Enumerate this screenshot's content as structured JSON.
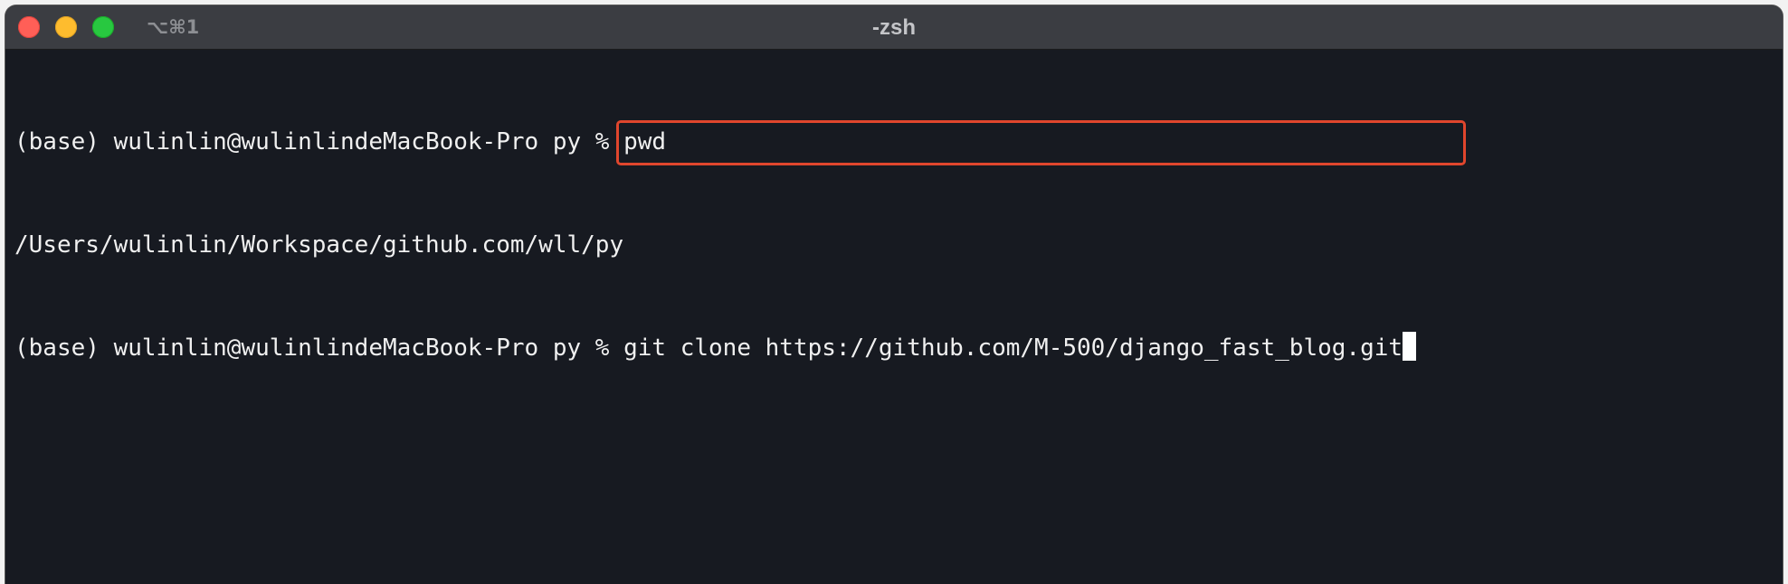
{
  "window": {
    "title": "-zsh",
    "shortcut": "⌥⌘1"
  },
  "terminal": {
    "lines": [
      "(base) wulinlin@wulinlindeMacBook-Pro py % pwd",
      "/Users/wulinlin/Workspace/github.com/wll/py",
      "(base) wulinlin@wulinlindeMacBook-Pro py % git clone https://github.com/M-500/django_fast_blog.git"
    ]
  },
  "colors": {
    "terminal_background": "#171a21",
    "terminal_text": "#f0f0f0",
    "highlight_box": "#e0462d"
  }
}
